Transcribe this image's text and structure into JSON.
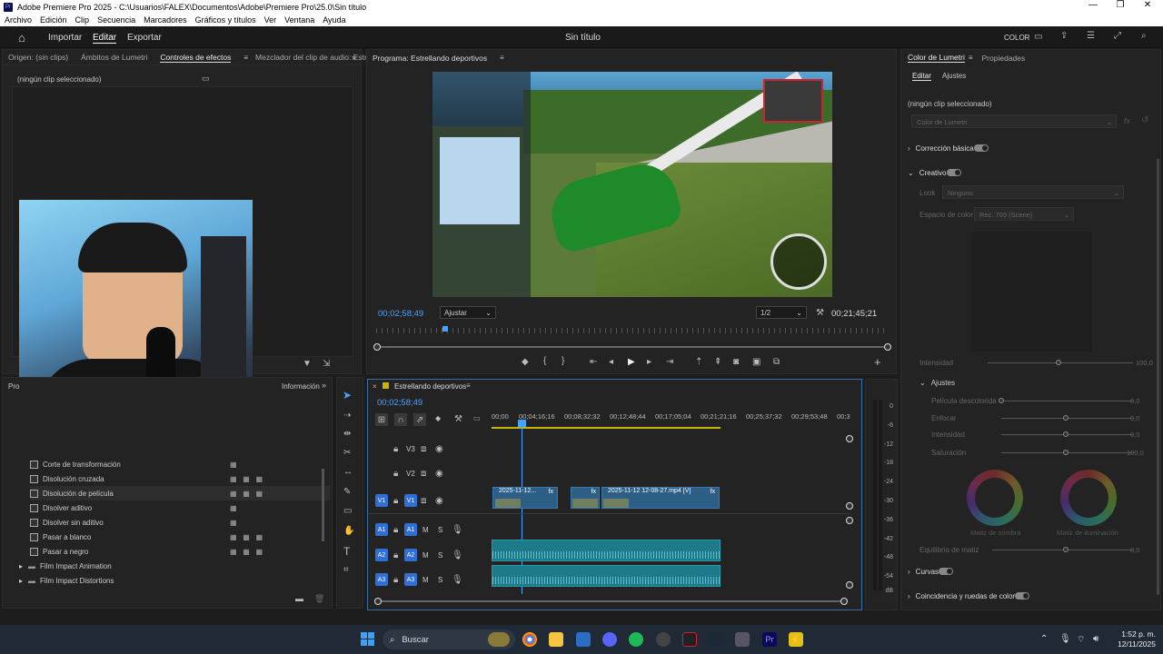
{
  "window": {
    "title": "Adobe Premiere Pro 2025 - C:\\Usuarios\\FALEX\\Documentos\\Adobe\\Premiere Pro\\25.0\\Sin título",
    "app_icon": "Pr"
  },
  "menu": [
    "Archivo",
    "Edición",
    "Clip",
    "Secuencia",
    "Marcadores",
    "Gráficos y títulos",
    "Ver",
    "Ventana",
    "Ayuda"
  ],
  "header": {
    "tabs": [
      "Importar",
      "Editar",
      "Exportar"
    ],
    "active_tab": "Editar",
    "project_title": "Sin título",
    "color_label": "COLOR"
  },
  "source_panel": {
    "tabs": [
      "Origen: (sin clips)",
      "Ámbitos de Lumetri",
      "Controles de efectos",
      "Mezclador del clip de audio: Estr"
    ],
    "active_tab": "Controles de efectos",
    "no_clip": "(ningún clip seleccionado)"
  },
  "program_monitor": {
    "title": "Programa: Estrellando deportivos",
    "timecode_current": "00;02;58;49",
    "fit": "Ajustar",
    "resolution": "1/2",
    "timecode_total": "00;21;45;21"
  },
  "project_panel": {
    "tab_left": "Pro",
    "tab_right": "Información",
    "items": [
      {
        "label": "Corte de transformación",
        "badges": 1
      },
      {
        "label": "Disolución cruzada",
        "badges": 3
      },
      {
        "label": "Disolución de película",
        "badges": 3
      },
      {
        "label": "Disolver aditivo",
        "badges": 1
      },
      {
        "label": "Disolver sin aditivo",
        "badges": 1
      },
      {
        "label": "Pasar a blanco",
        "badges": 3
      },
      {
        "label": "Pasar a negro",
        "badges": 3
      }
    ],
    "folders": [
      "Film Impact Animation",
      "Film Impact Distortions"
    ]
  },
  "timeline": {
    "sequence_name": "Estrellando deportivos",
    "timecode": "00;02;58;49",
    "ruler": [
      "00;00",
      "00;04;16;16",
      "00;08;32;32",
      "00;12;48;44",
      "00;17;05;04",
      "00;21;21;16",
      "00;25;37;32",
      "00;29;53;48",
      "00;3"
    ],
    "tracks_video": [
      "V3",
      "V2",
      "V1"
    ],
    "tracks_audio": [
      "A1",
      "A2",
      "A3"
    ],
    "clip_v1a": "2025-11-12...",
    "clip_v1b": "2025-11-12 12-08-27.mp4 [V]",
    "fx": "fx",
    "mute": "M",
    "solo": "S"
  },
  "meter": {
    "labels": [
      "0",
      "-6",
      "-12",
      "-18",
      "-24",
      "-30",
      "-36",
      "-42",
      "-48",
      "-54",
      "dB"
    ]
  },
  "lumetri": {
    "tabs": [
      "Color de Lumetri",
      "Propiedades"
    ],
    "subtabs": [
      "Editar",
      "Ajustes"
    ],
    "no_clip": "(ningún clip seleccionado)",
    "dropdown": "Color de Lumetri",
    "sections": {
      "basic": "Corrección básica",
      "creative": "Creativo",
      "curves": "Curvas",
      "match": "Coincidencia y ruedas de color"
    },
    "look_label": "Look",
    "look_value": "Ninguno",
    "colorspace_label": "Espacio de color",
    "colorspace_value": "Rec. 709 (Scene)",
    "intensity_label": "Intensidad",
    "intensity_value": "100,0",
    "ajustes_label": "Ajustes",
    "adjustments": [
      {
        "label": "Película descolorida",
        "value": "0,0"
      },
      {
        "label": "Enfocar",
        "value": "0,0"
      },
      {
        "label": "Intensidad",
        "value": "0,0"
      },
      {
        "label": "Saturación",
        "value": "100,0"
      }
    ],
    "wheel_shadow": "Matiz de sombra",
    "wheel_highlight": "Matiz de iluminación",
    "balance_label": "Equilibrio de matiz",
    "balance_value": "0,0"
  },
  "taskbar": {
    "search": "Buscar",
    "time": "1:52 p. m.",
    "date": "12/11/2025"
  }
}
